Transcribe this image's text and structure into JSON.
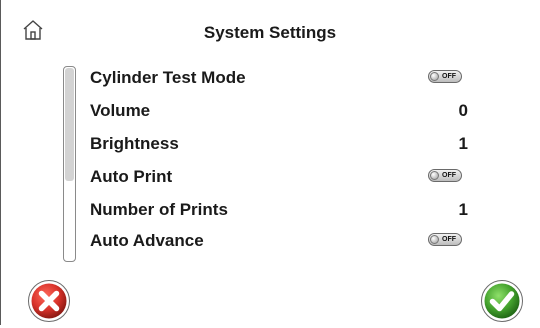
{
  "header": {
    "title": "System Settings",
    "home_icon": "home-icon"
  },
  "settings": [
    {
      "label": "Cylinder Test Mode",
      "type": "toggle",
      "value": "OFF"
    },
    {
      "label": "Volume",
      "type": "number",
      "value": "0"
    },
    {
      "label": "Brightness",
      "type": "number",
      "value": "1"
    },
    {
      "label": "Auto Print",
      "type": "toggle",
      "value": "OFF"
    },
    {
      "label": "Number of Prints",
      "type": "number",
      "value": "1"
    },
    {
      "label": "Auto Advance",
      "type": "toggle",
      "value": "OFF"
    }
  ],
  "footer": {
    "cancel_icon": "cancel-x-icon",
    "confirm_icon": "confirm-check-icon"
  },
  "colors": {
    "cancel": "#d9332b",
    "confirm": "#45a32e"
  }
}
